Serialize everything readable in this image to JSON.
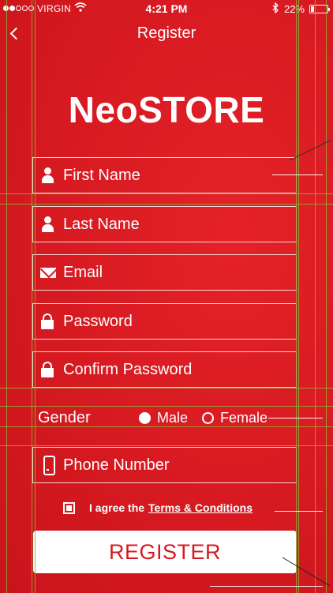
{
  "status_bar": {
    "carrier": "VIRGIN",
    "time": "4:21 PM",
    "battery": "22%",
    "battery_level": 0.22,
    "signal_icon": "signal-dots-icon",
    "wifi_icon": "wifi-icon",
    "bluetooth_icon": "bluetooth-icon"
  },
  "nav": {
    "title": "Register",
    "back_icon": "chevron-left-icon"
  },
  "brand": {
    "logo": "NeoSTORE"
  },
  "form": {
    "first_name": {
      "placeholder": "First Name",
      "icon": "person-icon"
    },
    "last_name": {
      "placeholder": "Last Name",
      "icon": "person-icon"
    },
    "email": {
      "placeholder": "Email",
      "icon": "mail-icon"
    },
    "password": {
      "placeholder": "Password",
      "icon": "lock-icon"
    },
    "confirm_password": {
      "placeholder": "Confirm Password",
      "icon": "lock-icon"
    },
    "gender": {
      "label": "Gender",
      "options": [
        {
          "label": "Male",
          "selected": true
        },
        {
          "label": "Female",
          "selected": false
        }
      ]
    },
    "phone": {
      "placeholder": "Phone Number",
      "icon": "phone-icon"
    },
    "terms": {
      "prefix": "I agree the",
      "link": "Terms & Conditions",
      "checked": true
    },
    "submit_label": "REGISTER"
  },
  "colors": {
    "background": "#d71820",
    "accent": "#ffffff",
    "button_text": "#d71820",
    "guide_lines": "#8fae3a"
  }
}
